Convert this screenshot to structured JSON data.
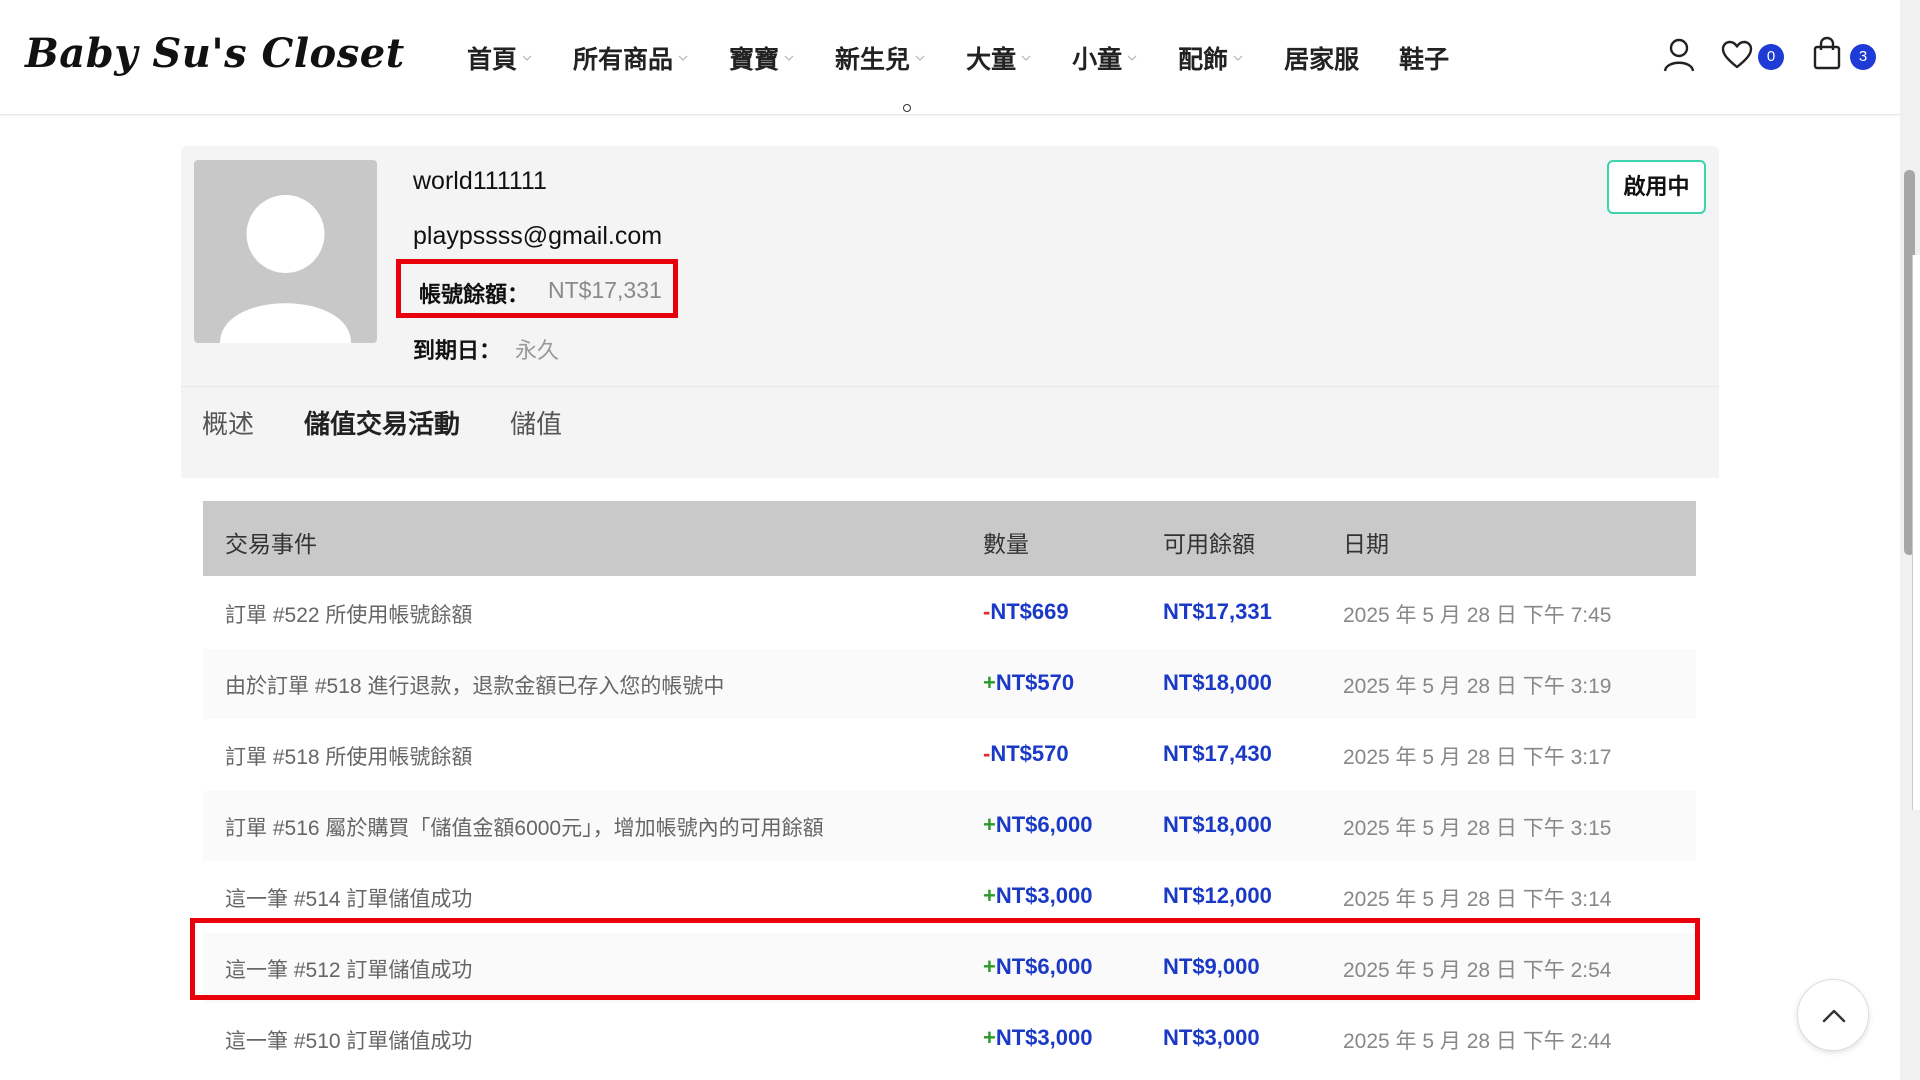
{
  "header": {
    "logo": "Baby Su's Closet",
    "nav": [
      {
        "label": "首頁",
        "dropdown": true
      },
      {
        "label": "所有商品",
        "dropdown": true
      },
      {
        "label": "寶寶",
        "dropdown": true
      },
      {
        "label": "新生兒",
        "dropdown": true
      },
      {
        "label": "大童",
        "dropdown": true
      },
      {
        "label": "小童",
        "dropdown": true
      },
      {
        "label": "配飾",
        "dropdown": true
      },
      {
        "label": "居家服",
        "dropdown": false
      },
      {
        "label": "鞋子",
        "dropdown": false
      }
    ],
    "wishlist_count": "0",
    "cart_count": "3",
    "icons": [
      "user-icon",
      "heart-icon",
      "shopping-bag-icon"
    ]
  },
  "profile": {
    "username": "world111111",
    "email": "playpssss@gmail.com",
    "balance_label": "帳號餘額：",
    "balance_value": "NT$17,331",
    "expiry_label": "到期日：",
    "expiry_value": "永久",
    "status": "啟用中"
  },
  "tabs": [
    {
      "label": "概述",
      "active": false
    },
    {
      "label": "儲值交易活動",
      "active": true
    },
    {
      "label": "儲值",
      "active": false
    }
  ],
  "table": {
    "headers": [
      "交易事件",
      "數量",
      "可用餘額",
      "日期"
    ],
    "rows": [
      {
        "event": "訂單 #522 所使用帳號餘額",
        "sign": "-",
        "amount": "NT$669",
        "available": "NT$17,331",
        "date": "2025 年 5 月 28 日 下午 7:45"
      },
      {
        "event": "由於訂單 #518 進行退款，退款金額已存入您的帳號中",
        "sign": "+",
        "amount": "NT$570",
        "available": "NT$18,000",
        "date": "2025 年 5 月 28 日 下午 3:19"
      },
      {
        "event": "訂單 #518 所使用帳號餘額",
        "sign": "-",
        "amount": "NT$570",
        "available": "NT$17,430",
        "date": "2025 年 5 月 28 日 下午 3:17"
      },
      {
        "event": "訂單 #516 屬於購買「儲值金額6000元」，增加帳號內的可用餘額",
        "sign": "+",
        "amount": "NT$6,000",
        "available": "NT$18,000",
        "date": "2025 年 5 月 28 日 下午 3:15"
      },
      {
        "event": "這一筆 #514 訂單儲值成功",
        "sign": "+",
        "amount": "NT$3,000",
        "available": "NT$12,000",
        "date": "2025 年 5 月 28 日 下午 3:14"
      },
      {
        "event": "這一筆 #512 訂單儲值成功",
        "sign": "+",
        "amount": "NT$6,000",
        "available": "NT$9,000",
        "date": "2025 年 5 月 28 日 下午 2:54"
      },
      {
        "event": "這一筆 #510 訂單儲值成功",
        "sign": "+",
        "amount": "NT$3,000",
        "available": "NT$3,000",
        "date": "2025 年 5 月 28 日 下午 2:44"
      }
    ]
  },
  "colors": {
    "accent_blue": "#1a39c6",
    "minus_red": "#e32b2b",
    "plus_green": "#2a9a2a",
    "highlight_red": "#e8000b",
    "status_border": "#3dd4ad"
  }
}
